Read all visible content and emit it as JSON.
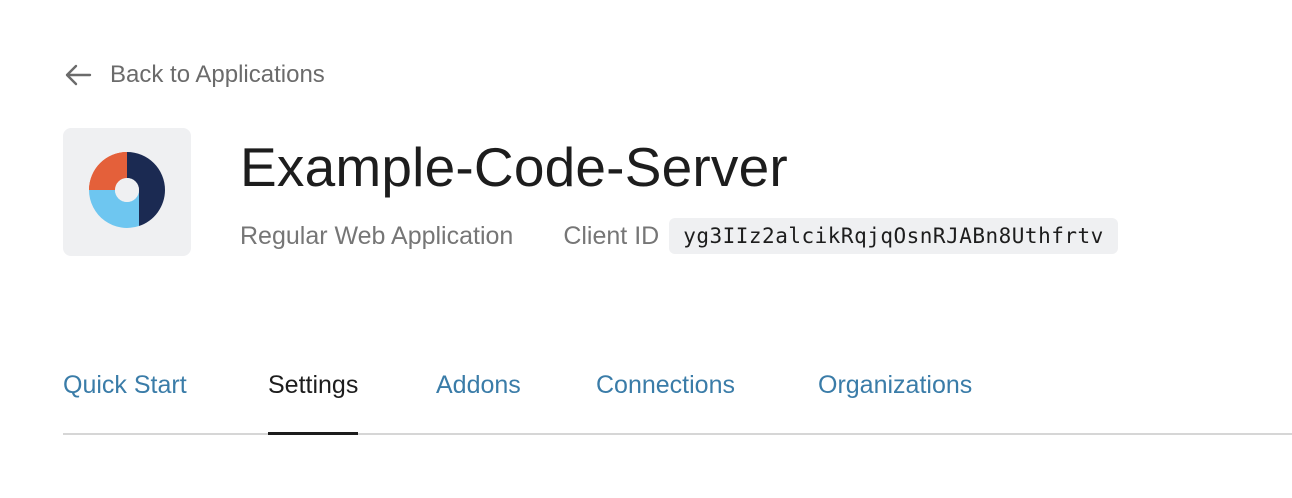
{
  "back_link": {
    "label": "Back to Applications",
    "icon": "arrow-left-icon"
  },
  "application": {
    "name": "Example-Code-Server",
    "type": "Regular Web Application",
    "client_id_label": "Client ID",
    "client_id": "yg3IIz2alcikRqjqOsnRJABn8Uthfrtv",
    "logo_icon": "app-logo-icon",
    "logo_colors": [
      "#e4603a",
      "#1b2a52",
      "#6ec6f0",
      "#eff0f2"
    ]
  },
  "tabs": [
    {
      "label": "Quick Start",
      "active": false
    },
    {
      "label": "Settings",
      "active": true
    },
    {
      "label": "Addons",
      "active": false
    },
    {
      "label": "Connections",
      "active": false
    },
    {
      "label": "Organizations",
      "active": false
    }
  ],
  "colors": {
    "tab_link": "#3a7ca8",
    "text_primary": "#1d1d1d",
    "text_secondary": "#767676",
    "divider": "#d6d6d6"
  }
}
